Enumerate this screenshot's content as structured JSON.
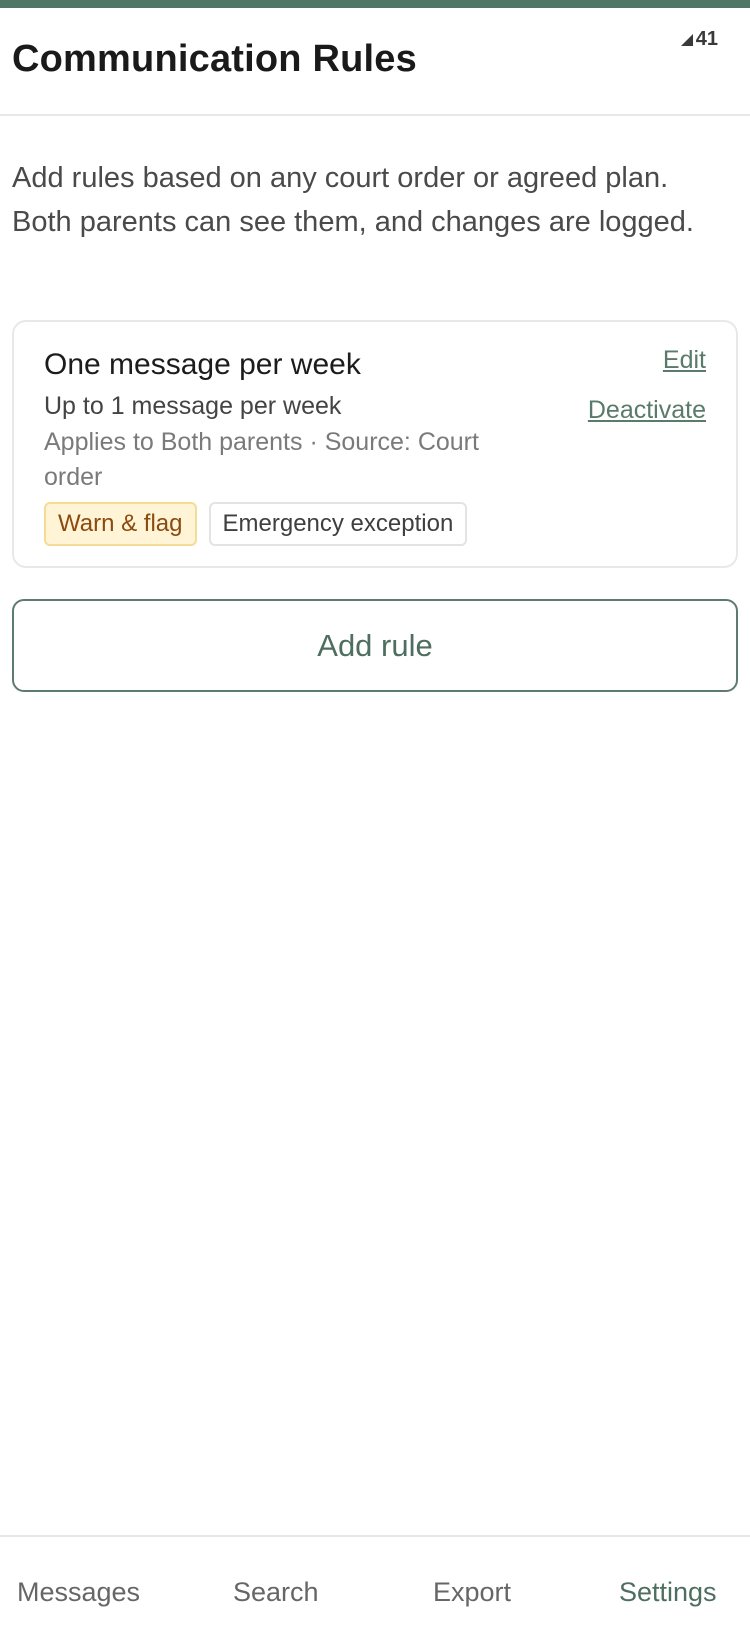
{
  "header": {
    "title": "Communication Rules",
    "status": {
      "icon": "signal-icon",
      "value": "41"
    }
  },
  "intro": "Add rules based on any court order or agreed plan. Both parents can see them, and changes are logged.",
  "rules": [
    {
      "title": "One message per week",
      "limit": "Up to 1 message per week",
      "applies": "Applies to Both parents · Source: Court order",
      "edit_label": "Edit",
      "deactivate_label": "Deactivate",
      "tags": [
        {
          "label": "Warn & flag",
          "style": "warning"
        },
        {
          "label": "Emergency exception",
          "style": "neutral"
        }
      ]
    }
  ],
  "add_rule_label": "Add rule",
  "nav": [
    {
      "label": "Messages",
      "active": false
    },
    {
      "label": "Search",
      "active": false
    },
    {
      "label": "Export",
      "active": false
    },
    {
      "label": "Settings",
      "active": true
    }
  ],
  "colors": {
    "accent": "#4f7667",
    "warning_bg": "#fff5d6",
    "warning_text": "#8a4a10"
  }
}
